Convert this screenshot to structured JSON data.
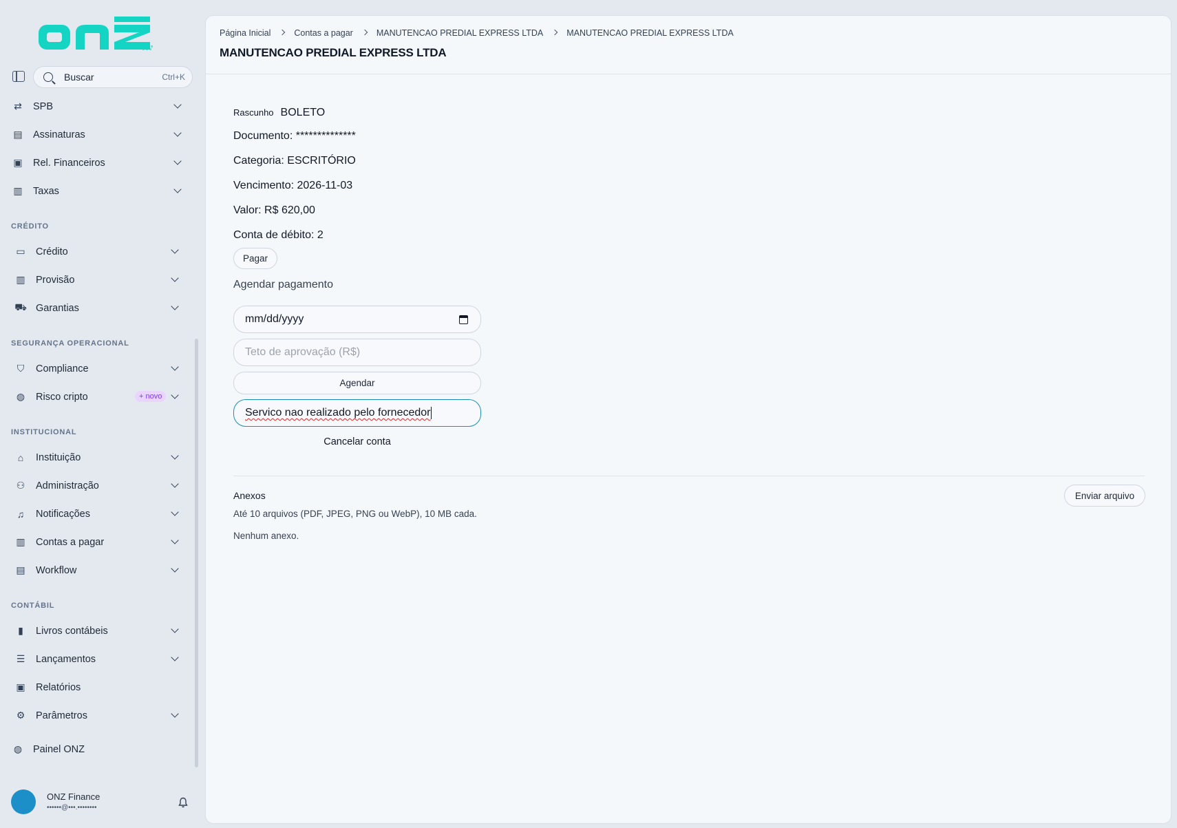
{
  "brand": {
    "logo_text": "onz",
    "logo_color": "#14d4c4"
  },
  "search": {
    "label": "Buscar",
    "shortcut": "Ctrl+K"
  },
  "sidebar": {
    "items_top": [
      {
        "label": "SPB",
        "icon": "transfer-icon"
      },
      {
        "label": "Assinaturas",
        "icon": "document-check-icon"
      },
      {
        "label": "Rel. Financeiros",
        "icon": "clipboard-icon"
      },
      {
        "label": "Taxas",
        "icon": "banknote-icon"
      }
    ],
    "sections": [
      {
        "title": "CRÉDITO",
        "items": [
          {
            "label": "Crédito",
            "icon": "credit-card-icon"
          },
          {
            "label": "Provisão",
            "icon": "banknote-icon"
          },
          {
            "label": "Garantias",
            "icon": "car-shield-icon"
          }
        ]
      },
      {
        "title": "SEGURANÇA OPERACIONAL",
        "items": [
          {
            "label": "Compliance",
            "icon": "shield-icon"
          },
          {
            "label": "Risco cripto",
            "icon": "globe-icon",
            "badge": "+ novo"
          }
        ]
      },
      {
        "title": "INSTITUCIONAL",
        "items": [
          {
            "label": "Instituição",
            "icon": "bank-icon"
          },
          {
            "label": "Administração",
            "icon": "user-lock-icon"
          },
          {
            "label": "Notificações",
            "icon": "bell-icon"
          },
          {
            "label": "Contas a pagar",
            "icon": "money-icon"
          },
          {
            "label": "Workflow",
            "icon": "document-check-icon"
          }
        ]
      },
      {
        "title": "CONTÁBIL",
        "items": [
          {
            "label": "Livros contábeis",
            "icon": "book-icon"
          },
          {
            "label": "Lançamentos",
            "icon": "list-icon"
          },
          {
            "label": "Relatórios",
            "icon": "clipboard-icon"
          },
          {
            "label": "Parâmetros",
            "icon": "gear-icon"
          }
        ]
      }
    ],
    "panel_link": "Painel ONZ",
    "user": {
      "name": "ONZ Finance",
      "email": "••••••@•••.••••••••"
    }
  },
  "breadcrumb": [
    "Página Inicial",
    "Contas a pagar",
    "MANUTENCAO PREDIAL EXPRESS LTDA",
    "MANUTENCAO PREDIAL EXPRESS LTDA"
  ],
  "page": {
    "title": "MANUTENCAO PREDIAL EXPRESS LTDA",
    "status": "Rascunho",
    "payment_type": "BOLETO",
    "documento": "Documento: **************",
    "categoria": "Categoria: ESCRITÓRIO",
    "vencimento": "Vencimento: 2026-11-03",
    "valor": "Valor: R$ 620,00",
    "conta_debito": "Conta de débito: 2",
    "pay_button": "Pagar",
    "schedule_title": "Agendar pagamento",
    "date_placeholder": "mm/dd/yyyy",
    "ceiling_placeholder": "Teto de aprovação (R$)",
    "schedule_button": "Agendar",
    "cancel_reason_value": "Servico nao realizado pelo fornecedor",
    "cancel_button": "Cancelar conta"
  },
  "attachments": {
    "title": "Anexos",
    "help": "Até 10 arquivos (PDF, JPEG, PNG ou WebP), 10 MB cada.",
    "empty": "Nenhum anexo.",
    "upload_button": "Enviar arquivo"
  }
}
